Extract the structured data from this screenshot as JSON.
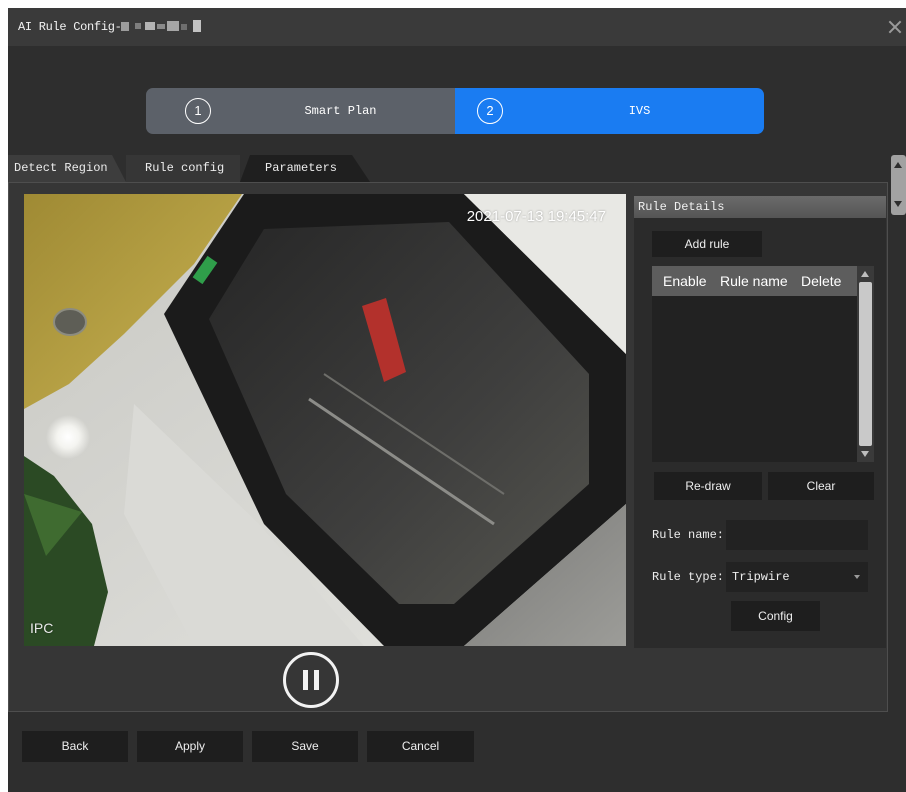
{
  "window": {
    "title": "AI Rule Config-",
    "close_icon": "close-icon"
  },
  "steps": [
    {
      "number": "1",
      "label": "Smart Plan",
      "state": "inactive"
    },
    {
      "number": "2",
      "label": "IVS",
      "state": "active"
    }
  ],
  "tabs": [
    {
      "label": "Detect Region",
      "selected": false
    },
    {
      "label": "Rule config",
      "selected": true
    },
    {
      "label": "Parameters",
      "selected": false
    }
  ],
  "video": {
    "timestamp": "2021-07-13 19:45:47",
    "channel_label": "IPC",
    "playback_icon": "pause-icon"
  },
  "rule_details": {
    "title": "Rule Details",
    "add_rule_label": "Add rule",
    "table": {
      "headers": [
        "Enable",
        "Rule name",
        "Delete"
      ],
      "rows": []
    },
    "redraw_label": "Re-draw",
    "clear_label": "Clear",
    "rule_name_label": "Rule name:",
    "rule_name_value": "",
    "rule_type_label": "Rule type:",
    "rule_type_value": "Tripwire",
    "config_label": "Config"
  },
  "footer": {
    "back_label": "Back",
    "apply_label": "Apply",
    "save_label": "Save",
    "cancel_label": "Cancel"
  },
  "colors": {
    "accent": "#1a7cf2",
    "step_inactive": "#5c6169",
    "dialog_background": "#2e2e2e"
  }
}
